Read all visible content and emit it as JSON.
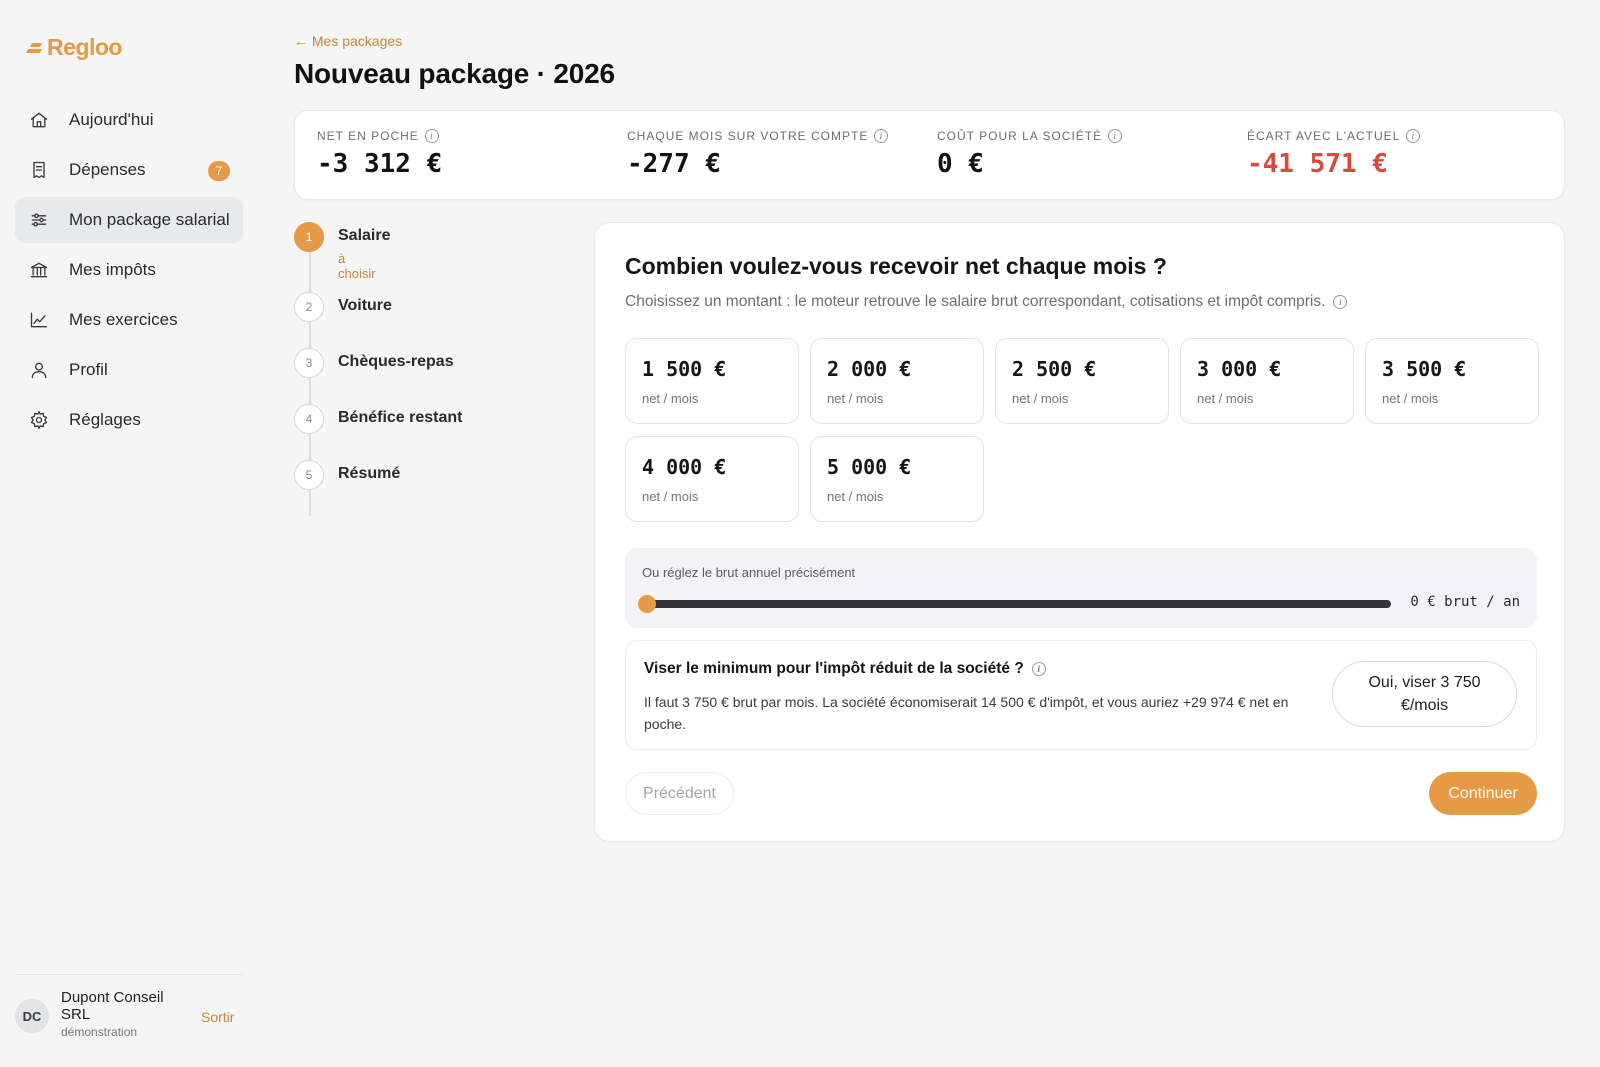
{
  "brand": {
    "name": "Regloo",
    "color": "#e69a45"
  },
  "sidebar": {
    "items": [
      {
        "label": "Aujourd'hui",
        "icon": "home-icon"
      },
      {
        "label": "Dépenses",
        "icon": "receipt-icon",
        "badge": "7"
      },
      {
        "label": "Mon package salarial",
        "icon": "sliders-icon",
        "active": true
      },
      {
        "label": "Mes impôts",
        "icon": "bank-icon"
      },
      {
        "label": "Mes exercices",
        "icon": "chart-line-icon"
      },
      {
        "label": "Profil",
        "icon": "user-icon"
      },
      {
        "label": "Réglages",
        "icon": "gear-icon"
      }
    ],
    "user": {
      "initials": "DC",
      "name": "Dupont Conseil SRL",
      "subtitle": "démonstration",
      "logout": "Sortir"
    }
  },
  "header": {
    "back": "← Mes packages",
    "title": "Nouveau package · 2026"
  },
  "stats": [
    {
      "label": "NET EN POCHE",
      "value": "-3 312 €",
      "negative": false
    },
    {
      "label": "CHAQUE MOIS SUR VOTRE COMPTE",
      "value": "-277 €",
      "negative": false
    },
    {
      "label": "COÛT POUR LA SOCIÉTÉ",
      "value": "0 €",
      "negative": false
    },
    {
      "label": "ÉCART AVEC L'ACTUEL",
      "value": "-41 571 €",
      "negative": true,
      "color": "#d84a3b"
    }
  ],
  "steps": [
    {
      "number": "1",
      "label": "Salaire",
      "sub": "à choisir",
      "active": true
    },
    {
      "number": "2",
      "label": "Voiture"
    },
    {
      "number": "3",
      "label": "Chèques-repas"
    },
    {
      "number": "4",
      "label": "Bénéfice restant"
    },
    {
      "number": "5",
      "label": "Résumé"
    }
  ],
  "main": {
    "title": "Combien voulez-vous recevoir net chaque mois ?",
    "subtitle": "Choisissez un montant : le moteur retrouve le salaire brut correspondant, cotisations et impôt compris.",
    "amounts": [
      {
        "value": "1 500 €",
        "unit": "net / mois"
      },
      {
        "value": "2 000 €",
        "unit": "net / mois"
      },
      {
        "value": "2 500 €",
        "unit": "net / mois"
      },
      {
        "value": "3 000 €",
        "unit": "net / mois"
      },
      {
        "value": "3 500 €",
        "unit": "net / mois"
      },
      {
        "value": "4 000 €",
        "unit": "net / mois"
      },
      {
        "value": "5 000 €",
        "unit": "net / mois"
      }
    ],
    "slider": {
      "label": "Ou réglez le brut annuel précisément",
      "value_text": "0 € brut / an",
      "fraction": 0
    },
    "tip": {
      "title": "Viser le minimum pour l'impôt réduit de la société ?",
      "text": "Il faut 3 750 € brut par mois. La société économiserait 14 500 € d'impôt, et vous auriez +29 974 € net en poche.",
      "button": "Oui, viser 3 750 €/mois"
    },
    "prev": "Précédent",
    "next": "Continuer"
  }
}
